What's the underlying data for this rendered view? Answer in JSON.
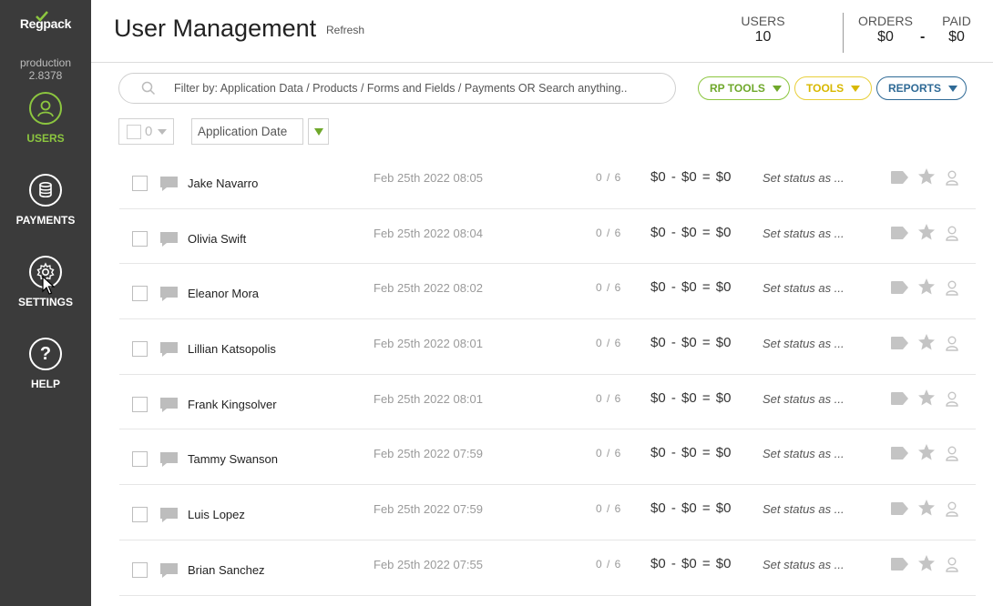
{
  "sidebar": {
    "logo": "Regpack",
    "environment": "production",
    "version": "2.8378",
    "items": [
      {
        "label": "USERS",
        "icon": "user-icon",
        "active": true
      },
      {
        "label": "PAYMENTS",
        "icon": "coins-icon",
        "active": false
      },
      {
        "label": "SETTINGS",
        "icon": "gear-icon",
        "active": false
      },
      {
        "label": "HELP",
        "icon": "question-icon",
        "active": false
      }
    ]
  },
  "header": {
    "title": "User Management",
    "refresh_label": "Refresh",
    "stats": {
      "users_label": "USERS",
      "users_value": "10",
      "orders_label": "ORDERS",
      "orders_value": "$0",
      "paid_label": "PAID",
      "paid_value": "$0",
      "separator": "-"
    }
  },
  "toolbar": {
    "search_placeholder": "Filter by: Application Data / Products / Forms and Fields / Payments OR Search anything..",
    "rp_tools_label": "RP TOOLS",
    "tools_label": "TOOLS",
    "reports_label": "REPORTS",
    "selected_count": "0",
    "sort_field": "Application Date"
  },
  "colors": {
    "sidebar_bg": "#3b3b3b",
    "accent_green": "#8cc63f",
    "tools_yellow": "#e8cf3a",
    "reports_blue": "#2f6a96"
  },
  "users": [
    {
      "name": "Jake Navarro",
      "date": "Feb 25th 2022 08:05",
      "forms": "0 / 6",
      "money": "$0 - $0 = $0",
      "status": "Set status as ..."
    },
    {
      "name": "Olivia Swift",
      "date": "Feb 25th 2022 08:04",
      "forms": "0 / 6",
      "money": "$0 - $0 = $0",
      "status": "Set status as ..."
    },
    {
      "name": "Eleanor Mora",
      "date": "Feb 25th 2022 08:02",
      "forms": "0 / 6",
      "money": "$0 - $0 = $0",
      "status": "Set status as ..."
    },
    {
      "name": "Lillian Katsopolis",
      "date": "Feb 25th 2022 08:01",
      "forms": "0 / 6",
      "money": "$0 - $0 = $0",
      "status": "Set status as ..."
    },
    {
      "name": "Frank Kingsolver",
      "date": "Feb 25th 2022 08:01",
      "forms": "0 / 6",
      "money": "$0 - $0 = $0",
      "status": "Set status as ..."
    },
    {
      "name": "Tammy Swanson",
      "date": "Feb 25th 2022 07:59",
      "forms": "0 / 6",
      "money": "$0 - $0 = $0",
      "status": "Set status as ..."
    },
    {
      "name": "Luis Lopez",
      "date": "Feb 25th 2022 07:59",
      "forms": "0 / 6",
      "money": "$0 - $0 = $0",
      "status": "Set status as ..."
    },
    {
      "name": "Brian Sanchez",
      "date": "Feb 25th 2022 07:55",
      "forms": "0 / 6",
      "money": "$0 - $0 = $0",
      "status": "Set status as ..."
    }
  ]
}
